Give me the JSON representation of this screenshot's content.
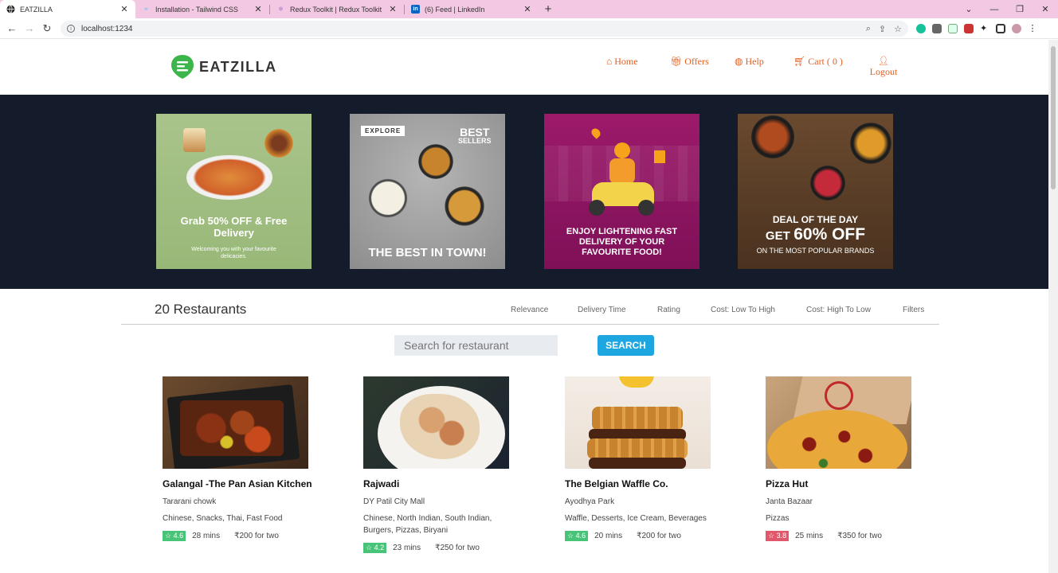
{
  "browser": {
    "tabs": [
      {
        "title": "EATZILLA",
        "active": true
      },
      {
        "title": "Installation - Tailwind CSS",
        "active": false
      },
      {
        "title": "Redux Toolkit | Redux Toolkit",
        "active": false
      },
      {
        "title": "(6) Feed | LinkedIn",
        "active": false
      }
    ],
    "url": "localhost:1234"
  },
  "header": {
    "brand": "EATZILLA",
    "nav": {
      "home": "Home",
      "offers": "Offers",
      "help": "Help",
      "cart": "Cart ( 0 )",
      "logout": "Logout"
    }
  },
  "banners": [
    {
      "headline": "Grab 50% OFF & Free Delivery",
      "sub": "Welcoming you with your favourite delicacies."
    },
    {
      "tag": "EXPLORE",
      "badge_top": "BEST",
      "badge_bottom": "SELLERS",
      "headline": "THE BEST IN TOWN!"
    },
    {
      "headline": "ENJOY LIGHTENING FAST DELIVERY OF YOUR FAVOURITE FOOD!"
    },
    {
      "line1": "DEAL OF THE DAY",
      "line2a": "GET",
      "line2b": "60% OFF",
      "line3": "ON THE MOST POPULAR BRANDS"
    }
  ],
  "listing": {
    "count_label": "20 Restaurants",
    "sorts": [
      "Relevance",
      "Delivery Time",
      "Rating",
      "Cost: Low To High",
      "Cost: High To Low",
      "Filters"
    ],
    "search_placeholder": "Search for restaurant",
    "search_button": "SEARCH"
  },
  "restaurants": [
    {
      "name": "Galangal -The Pan Asian Kitchen",
      "location": "Tararani chowk",
      "cuisines": "Chinese, Snacks, Thai, Fast Food",
      "rating": "☆ 4.6",
      "rating_color": "#48c479",
      "time": "28 mins",
      "cost": "₹200 for two"
    },
    {
      "name": "Rajwadi",
      "location": "DY Patil City Mall",
      "cuisines": "Chinese, North Indian, South Indian, Burgers, Pizzas, Biryani",
      "rating": "☆ 4.2",
      "rating_color": "#48c479",
      "time": "23 mins",
      "cost": "₹250 for two"
    },
    {
      "name": "The Belgian Waffle Co.",
      "location": "Ayodhya Park",
      "cuisines": "Waffle, Desserts, Ice Cream, Beverages",
      "rating": "☆ 4.6",
      "rating_color": "#48c479",
      "time": "20 mins",
      "cost": "₹200 for two"
    },
    {
      "name": "Pizza Hut",
      "location": "Janta Bazaar",
      "cuisines": "Pizzas",
      "rating": "☆ 3.8",
      "rating_color": "#e1586a",
      "time": "25 mins",
      "cost": "₹350 for two"
    }
  ],
  "colors": {
    "accent": "#e35f21",
    "search_button": "#1da6df",
    "banner_bg": "#141b2b"
  }
}
